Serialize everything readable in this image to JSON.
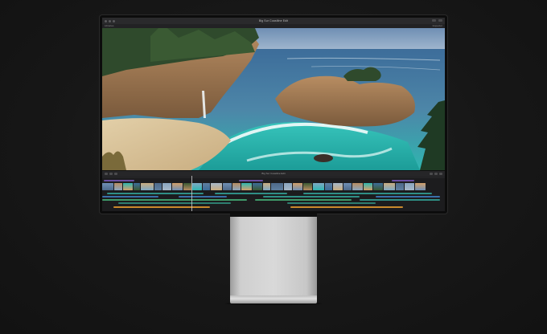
{
  "app": {
    "window_title": "Big Sur Coastline Edit",
    "toolbar_left": "Libraries",
    "toolbar_right": "Inspector",
    "timeline_title": "Big Sur Coastline Edit"
  },
  "colors": {
    "primary_clip": "#5c8fb5",
    "connected_teal": "#2f8f86",
    "connected_blue": "#3a6fa8",
    "audio_green": "#3f9a6a",
    "music_orange": "#c98a2c"
  },
  "icons": [
    "close-icon",
    "minimize-icon",
    "zoom-icon",
    "share-icon",
    "fullscreen-icon"
  ]
}
